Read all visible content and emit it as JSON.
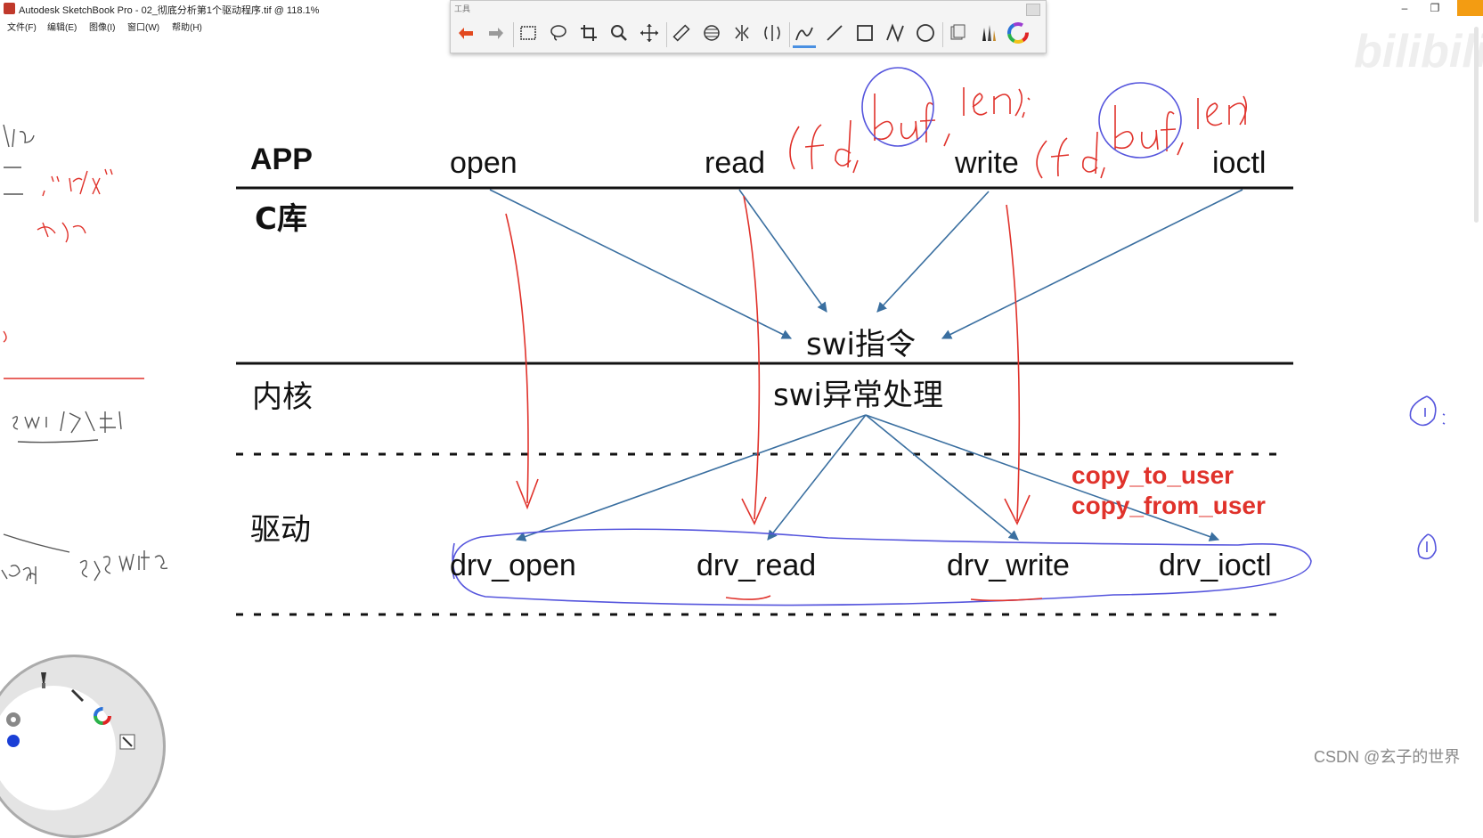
{
  "window": {
    "title": "Autodesk SketchBook Pro - 02_彻底分析第1个驱动程序.tif @ 118.1%",
    "menu": [
      "文件(F)",
      "编辑(E)",
      "图像(I)",
      "窗口(W)",
      "帮助(H)"
    ],
    "controls": {
      "minimize": "–",
      "restore": "❐"
    }
  },
  "toolbar": {
    "title": "工具",
    "tools": [
      "undo-icon",
      "redo-icon",
      "rect-select-icon",
      "lasso-icon",
      "crop-icon",
      "zoom-icon",
      "move-icon",
      "ruler-icon",
      "ellipse-guide-icon",
      "symmetry-icon",
      "symmetry2-icon",
      "pencil-icon",
      "line-icon",
      "rectangle-icon",
      "polyline-icon",
      "circle-icon",
      "layers-icon",
      "brushes-icon",
      "color-wheel-icon"
    ]
  },
  "diagram": {
    "rows": {
      "app": "APP",
      "clib": "C库",
      "kernel": "内核",
      "driver": "驱动"
    },
    "app_calls": [
      "open",
      "read",
      "write",
      "ioctl"
    ],
    "swi_instruction": "swi指令",
    "swi_handler": "swi异常处理",
    "drivers": [
      "drv_open",
      "drv_read",
      "drv_write",
      "drv_ioctl"
    ],
    "copy_notes": [
      "copy_to_user",
      "copy_from_user"
    ]
  },
  "watermark": "CSDN @玄子的世界",
  "colors": {
    "arrow": "#3a6fa0",
    "handwriting_red": "#e0322b",
    "handwriting_blue": "#5555dd",
    "line": "#111111"
  }
}
